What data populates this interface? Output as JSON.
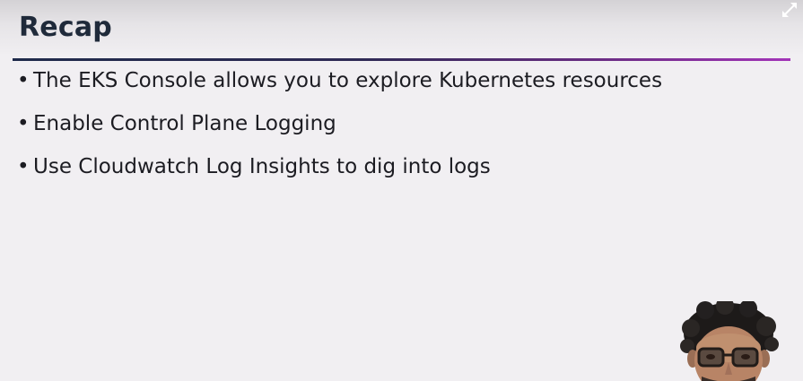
{
  "slide": {
    "title": "Recap",
    "bullets": [
      "The EKS Console allows you to explore Kubernetes resources",
      "Enable Control Plane Logging",
      "Use Cloudwatch Log Insights to dig into logs"
    ],
    "bullet_glyph": "•"
  },
  "icons": {
    "expand": "expand-fullscreen-icon"
  },
  "colors": {
    "background": "#f1eff2",
    "title": "#1f2a3a",
    "rule_start": "#1e2a4a",
    "rule_end": "#a334b8",
    "text": "#1c1c22"
  }
}
